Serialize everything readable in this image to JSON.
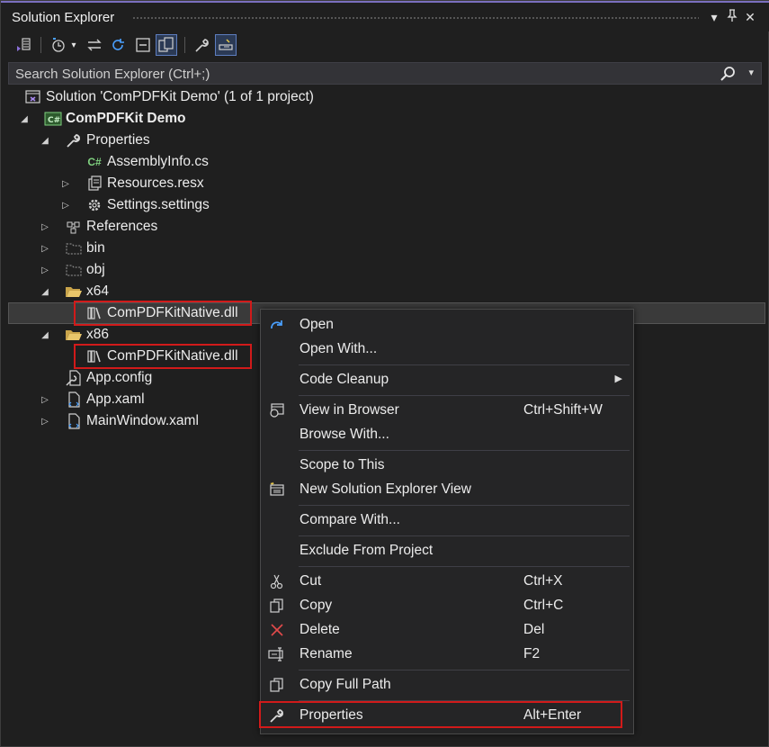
{
  "window": {
    "title": "Solution Explorer",
    "pin_glyph": "⊥",
    "close_glyph": "✕",
    "dropdown_glyph": "▾"
  },
  "search": {
    "placeholder": "Search Solution Explorer (Ctrl+;)"
  },
  "tree": {
    "solution": "Solution 'ComPDFKit Demo' (1 of 1 project)",
    "project": "ComPDFKit Demo",
    "properties": "Properties",
    "assemblyinfo": "AssemblyInfo.cs",
    "resources": "Resources.resx",
    "settings": "Settings.settings",
    "references": "References",
    "bin": "bin",
    "obj": "obj",
    "x64": "x64",
    "x64_dll": "ComPDFKitNative.dll",
    "x86": "x86",
    "x86_dll": "ComPDFKitNative.dll",
    "appconfig": "App.config",
    "appxaml": "App.xaml",
    "mainwindow": "MainWindow.xaml",
    "cs_badge": "C#"
  },
  "context_menu": {
    "open": "Open",
    "open_with": "Open With...",
    "code_cleanup": "Code Cleanup",
    "view_in_browser": "View in Browser",
    "view_in_browser_sc": "Ctrl+Shift+W",
    "browse_with": "Browse With...",
    "scope_to_this": "Scope to This",
    "new_view": "New Solution Explorer View",
    "compare_with": "Compare With...",
    "exclude": "Exclude From Project",
    "cut": "Cut",
    "cut_sc": "Ctrl+X",
    "copy": "Copy",
    "copy_sc": "Ctrl+C",
    "delete": "Delete",
    "delete_sc": "Del",
    "rename": "Rename",
    "rename_sc": "F2",
    "copy_full_path": "Copy Full Path",
    "properties": "Properties",
    "properties_sc": "Alt+Enter"
  },
  "colors": {
    "background": "#1f1f1f",
    "highlight_red": "#d11a1a",
    "accent": "#7a6fbf"
  }
}
